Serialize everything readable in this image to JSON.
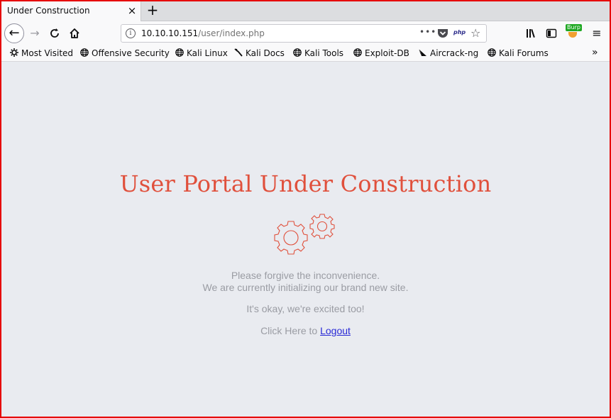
{
  "browser": {
    "tab": {
      "title": "Under Construction",
      "close_glyph": "×"
    },
    "new_tab_glyph": "+",
    "nav": {
      "back_glyph": "←",
      "forward_glyph": "→",
      "reload_glyph": "C",
      "home_glyph": "⌂"
    },
    "url": {
      "host": "10.10.10.151",
      "path": "/user/index.php",
      "more_glyph": "•••",
      "php_badge": "php",
      "star_glyph": "☆"
    },
    "toolbar": {
      "library_glyph": "|||\\",
      "sidebar_glyph": "▥",
      "burp_badge": "Burp",
      "menu_glyph": "≡"
    },
    "bookmarks": [
      {
        "label": "Most Visited",
        "icon": "gear-icon"
      },
      {
        "label": "Offensive Security",
        "icon": "globe-icon"
      },
      {
        "label": "Kali Linux",
        "icon": "globe-icon"
      },
      {
        "label": "Kali Docs",
        "icon": "kali-dragon-icon"
      },
      {
        "label": "Kali Tools",
        "icon": "globe-icon"
      },
      {
        "label": "Exploit-DB",
        "icon": "globe-icon"
      },
      {
        "label": "Aircrack-ng",
        "icon": "aircrack-icon"
      },
      {
        "label": "Kali Forums",
        "icon": "globe-icon"
      }
    ],
    "bookmarks_overflow_glyph": "»"
  },
  "page": {
    "heading": "User Portal Under Construction",
    "line1": "Please forgive the inconvenience.",
    "line2": "We are currently initializing our brand new site.",
    "line3": "It's okay, we're excited too!",
    "logout_prefix": "Click Here to",
    "logout_link": "Logout",
    "accent_color": "#e0503c"
  }
}
